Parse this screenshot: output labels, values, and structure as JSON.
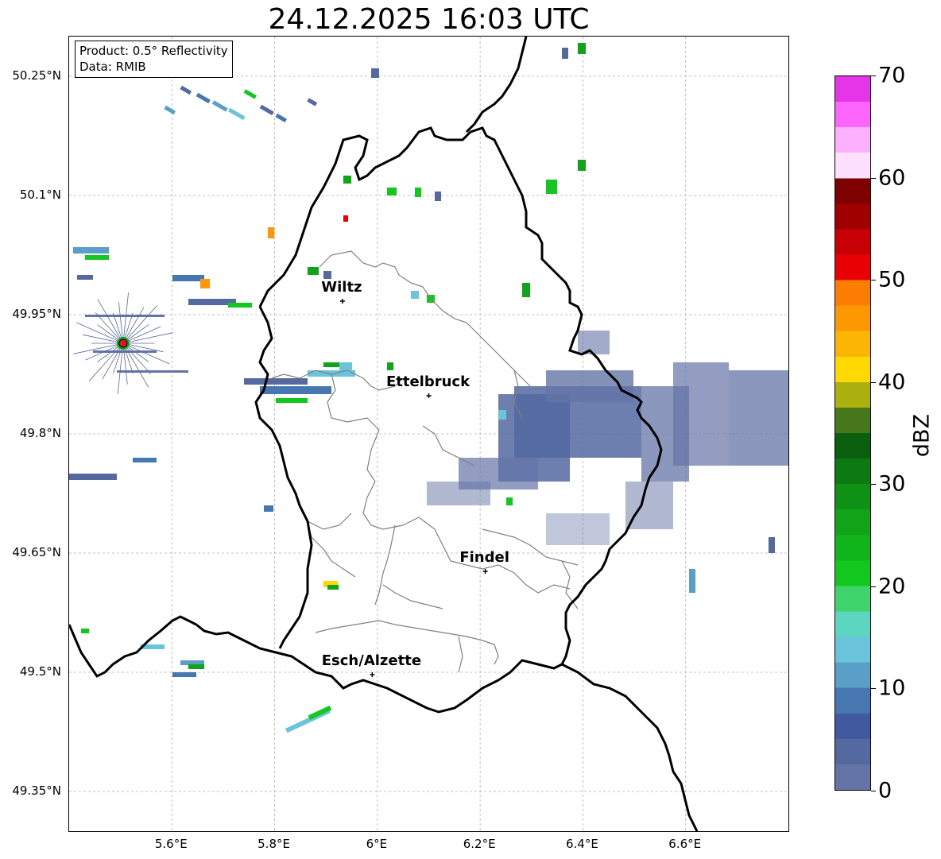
{
  "map": {
    "title": "24.12.2025 16:03 UTC",
    "info": {
      "product": "Product: 0.5° Reflectivity",
      "data": "Data: RMIB"
    },
    "extent": {
      "lon": [
        5.4,
        6.8
      ],
      "lat": [
        49.3,
        50.3
      ]
    },
    "lat_ticks": [
      {
        "value": 50.25,
        "label": "50.25°N"
      },
      {
        "value": 50.1,
        "label": "50.1°N"
      },
      {
        "value": 49.95,
        "label": "49.95°N"
      },
      {
        "value": 49.8,
        "label": "49.8°N"
      },
      {
        "value": 49.65,
        "label": "49.65°N"
      },
      {
        "value": 49.5,
        "label": "49.5°N"
      },
      {
        "value": 49.35,
        "label": "49.35°N"
      }
    ],
    "lon_ticks": [
      {
        "value": 5.6,
        "label": "5.6°E"
      },
      {
        "value": 5.8,
        "label": "5.8°E"
      },
      {
        "value": 6.0,
        "label": "6°E"
      },
      {
        "value": 6.2,
        "label": "6.2°E"
      },
      {
        "value": 6.4,
        "label": "6.4°E"
      },
      {
        "value": 6.6,
        "label": "6.6°E"
      }
    ],
    "cities": [
      {
        "name": "Wiltz",
        "lon": 5.932,
        "lat": 49.967
      },
      {
        "name": "Ettelbruck",
        "lon": 6.1,
        "lat": 49.848
      },
      {
        "name": "Findel",
        "lon": 6.21,
        "lat": 49.627
      },
      {
        "name": "Esch/Alzette",
        "lon": 5.99,
        "lat": 49.497
      }
    ],
    "radar_site": {
      "lon": 5.505,
      "lat": 49.914,
      "color": "#e8141b"
    },
    "grid": "on"
  },
  "colorbar": {
    "unit": "dBZ",
    "min": 0,
    "max": 70,
    "tick_labels": [
      "0",
      "10",
      "20",
      "30",
      "40",
      "50",
      "60",
      "70"
    ],
    "colors": [
      "#6474a6",
      "#5469a0",
      "#41599e",
      "#4677b0",
      "#5a9fc8",
      "#69c4dc",
      "#5cd6c0",
      "#3fd36b",
      "#12c81e",
      "#10b41b",
      "#12a418",
      "#0f9115",
      "#0c7a12",
      "#0a5f0e",
      "#46771a",
      "#acb00e",
      "#fed801",
      "#fdb504",
      "#fd9702",
      "#fc7d02",
      "#e80005",
      "#c80005",
      "#a10000",
      "#7e0000",
      "#fde0fd",
      "#fdb0fd",
      "#fd65fd",
      "#e635e9"
    ]
  }
}
